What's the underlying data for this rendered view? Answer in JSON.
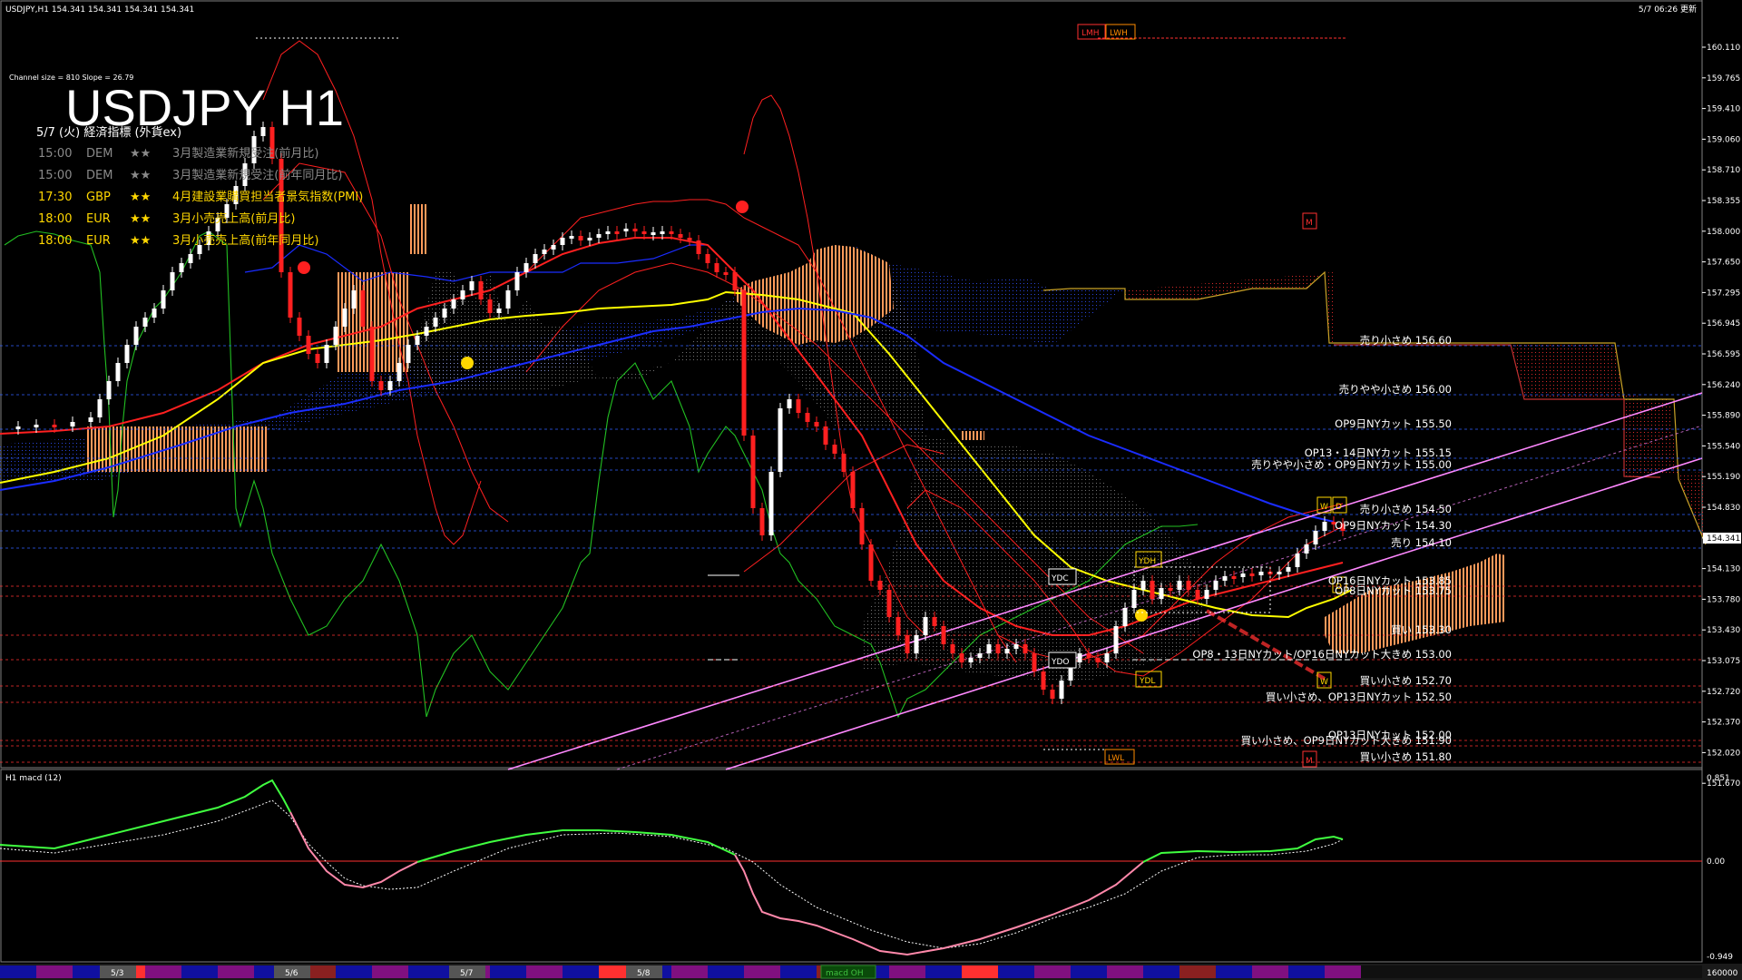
{
  "header": {
    "symbol_info": "USDJPY,H1  154.341 154.341 154.341 154.341",
    "timestamp": "5/7 06:26 更新",
    "channel_info": "Channel size = 810 Slope = 26.79",
    "big_title": "USDJPY H1"
  },
  "calendar": {
    "title": "5/7 (火) 経済指標 (外貨ex)",
    "events": [
      {
        "time": "15:00",
        "cur": "DEM",
        "stars": "★★",
        "name": "3月製造業新規受注(前月比)",
        "color": "#8a8a8a"
      },
      {
        "time": "15:00",
        "cur": "DEM",
        "stars": "★★",
        "name": "3月製造業新規受注(前年同月比)",
        "color": "#8a8a8a"
      },
      {
        "time": "17:30",
        "cur": "GBP",
        "stars": "★★",
        "name": "4月建設業購買担当者景気指数(PMI)",
        "color": "#ffd700"
      },
      {
        "time": "18:00",
        "cur": "EUR",
        "stars": "★★",
        "name": "3月小売売上高(前月比)",
        "color": "#ffd700"
      },
      {
        "time": "18:00",
        "cur": "EUR",
        "stars": "★★",
        "name": "3月小売売上高(前年同月比)",
        "color": "#ffd700"
      }
    ]
  },
  "price_axis": {
    "ticks": [
      "160.110",
      "159.765",
      "159.410",
      "159.060",
      "158.710",
      "158.355",
      "158.000",
      "157.650",
      "157.295",
      "156.945",
      "156.595",
      "156.240",
      "155.890",
      "155.540",
      "155.190",
      "154.830",
      "154.480",
      "154.130",
      "153.780",
      "153.430",
      "153.075",
      "152.720",
      "152.370",
      "152.020",
      "151.670"
    ],
    "current": "154.341"
  },
  "levels": [
    {
      "label": "売り小さめ 156.60",
      "color": "#ffffff"
    },
    {
      "label": "売りやや小さめ 156.00",
      "color": "#ffffff"
    },
    {
      "label": "OP9日NYカット 155.50",
      "color": "#ffffff"
    },
    {
      "label": "OP13・14日NYカット 155.15",
      "color": "#ffffff"
    },
    {
      "label": "売りやや小さめ・OP9日NYカット 155.00",
      "color": "#ffffff"
    },
    {
      "label": "売り小さめ 154.50",
      "color": "#ffffff"
    },
    {
      "label": "OP9日NYカット 154.30",
      "color": "#ffffff"
    },
    {
      "label": "売り 154.10",
      "color": "#ffffff"
    },
    {
      "label": "OP16日NYカット 153.85",
      "color": "#ffffff"
    },
    {
      "label": "OP8日NYカット 153.75",
      "color": "#ffffff"
    },
    {
      "label": "買い 153.30",
      "color": "#ffffff"
    },
    {
      "label": "OP8・13日NYカット/OP16日NYカット大きめ 153.00",
      "color": "#ffffff"
    },
    {
      "label": "買い小さめ 152.70",
      "color": "#ffffff"
    },
    {
      "label": "買い小さめ、OP13日NYカット 152.50",
      "color": "#ffffff"
    },
    {
      "label": "OP13日NYカット 152.00",
      "color": "#ffffff"
    },
    {
      "label": "買い小さめ、OP9日NYカット大きめ 151.90",
      "color": "#ffffff"
    },
    {
      "label": "買い小さめ 151.80",
      "color": "#ffffff"
    }
  ],
  "markers": {
    "lmh": "LMH",
    "lwh": "LWH",
    "m_top": "M",
    "m_bottom": "M",
    "ydh": "YDH",
    "ydc": "YDC",
    "ydo": "YDO",
    "ydl": "YDL",
    "w_top": "W",
    "d_top": "D",
    "d_mid": "D",
    "w_low": "W",
    "lwl": "LWL"
  },
  "macd": {
    "title": "H1  macd (12)",
    "ticks": [
      "0.851",
      "0.00",
      "-0.949"
    ]
  },
  "bottom_bar": {
    "dates": [
      "5/3",
      "5/6",
      "5/7",
      "5/8"
    ],
    "tab_label": "macd OH",
    "right_value": "160000"
  },
  "colors": {
    "ma_yellow": "#ffff00",
    "ma_blue": "#1a2cff",
    "bollinger_red": "#ff2020",
    "channel_pink": "#ff80ff",
    "cloud_orange": "#ffb070",
    "cloud_blue": "#3050ff",
    "chikou_green": "#22c022",
    "macd_green": "#40ff40",
    "macd_pink": "#ff88aa"
  }
}
